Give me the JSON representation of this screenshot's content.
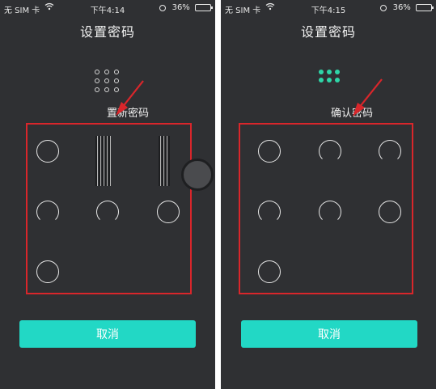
{
  "screens": [
    {
      "status": {
        "carrier": "无 SIM 卡",
        "time": "下午4:14",
        "battery": "36%",
        "battery_level": 0.36
      },
      "title": "设置密码",
      "instruction": "置新密码",
      "cancel_label": "取消",
      "mini_grid_style": "outline"
    },
    {
      "status": {
        "carrier": "无 SIM 卡",
        "time": "下午4:15",
        "battery": "36%",
        "battery_level": 0.36
      },
      "title": "设置密码",
      "instruction": "确认密码",
      "cancel_label": "取消",
      "mini_grid_style": "filled"
    }
  ],
  "colors": {
    "screen_bg": "#2f3033",
    "accent": "#22d8c5",
    "active_dot": "#2fd6a8",
    "annotation": "#d9262b"
  },
  "icons": [
    "wifi-icon",
    "lock-rotation-icon",
    "battery-icon",
    "annotation-arrow-icon"
  ]
}
